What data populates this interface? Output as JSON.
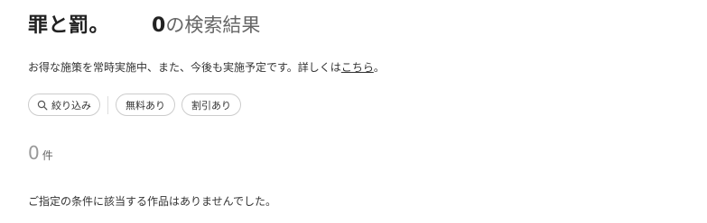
{
  "header": {
    "query": "罪と罰。",
    "result_count": "0",
    "result_suffix": "の検索結果"
  },
  "promo": {
    "text": "お得な施策を常時実施中、また、今後も実施予定です。詳しくは",
    "link_label": "こちら",
    "end": "。"
  },
  "filters": {
    "narrow_label": "絞り込み",
    "narrow_icon": "search-icon",
    "chips": [
      "無料あり",
      "割引あり"
    ]
  },
  "results": {
    "count": "0",
    "unit": "件",
    "empty_message": "ご指定の条件に該当する作品はありませんでした。"
  }
}
